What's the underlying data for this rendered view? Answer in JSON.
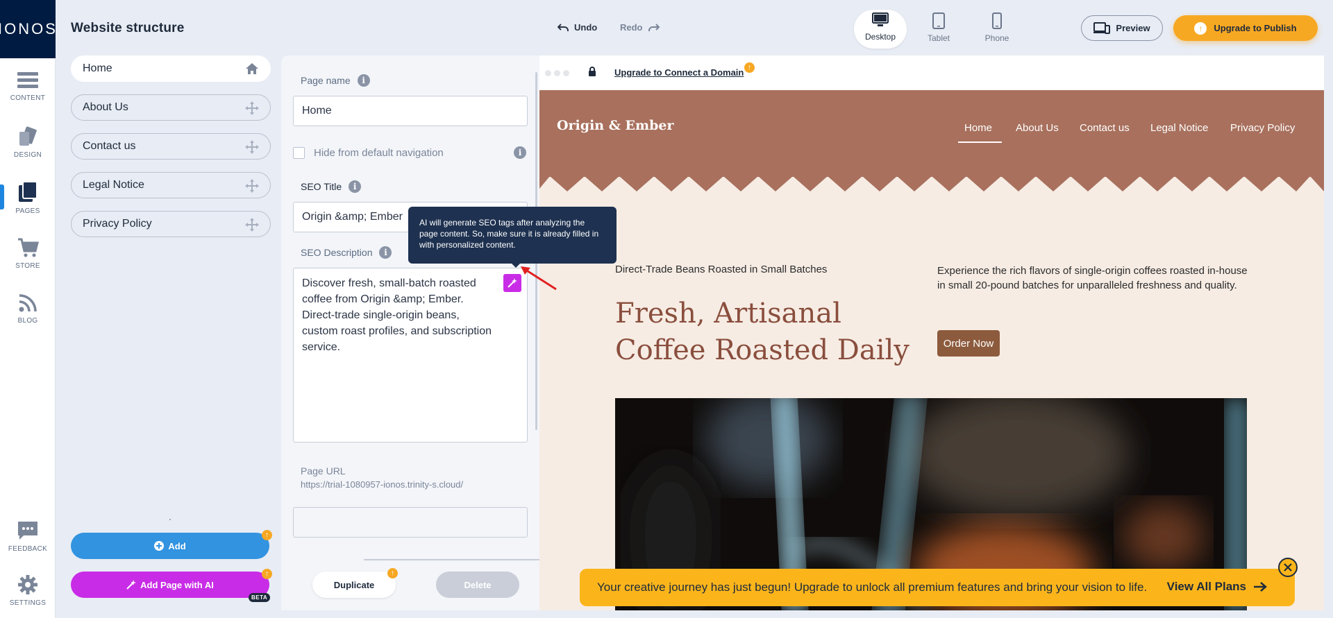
{
  "brand": {
    "logo": "IONOS"
  },
  "rail": {
    "items": [
      {
        "label": "CONTENT",
        "icon": "content-icon"
      },
      {
        "label": "DESIGN",
        "icon": "design-icon"
      },
      {
        "label": "PAGES",
        "icon": "pages-icon",
        "active": true
      },
      {
        "label": "STORE",
        "icon": "cart-icon"
      },
      {
        "label": "BLOG",
        "icon": "rss-icon"
      },
      {
        "label": "FEEDBACK",
        "icon": "feedback-icon"
      },
      {
        "label": "SETTINGS",
        "icon": "gear-icon"
      }
    ]
  },
  "header": {
    "title": "Website structure",
    "undo": "Undo",
    "redo": "Redo",
    "devices": [
      {
        "label": "Desktop",
        "active": true
      },
      {
        "label": "Tablet"
      },
      {
        "label": "Phone"
      }
    ],
    "preview": "Preview",
    "upgrade": "Upgrade to Publish"
  },
  "pages": {
    "items": [
      {
        "label": "Home",
        "icon": "home-icon",
        "active": true
      },
      {
        "label": "About Us",
        "icon": "move-icon"
      },
      {
        "label": "Contact us",
        "icon": "move-icon"
      },
      {
        "label": "Legal Notice",
        "icon": "move-icon"
      },
      {
        "label": "Privacy Policy",
        "icon": "move-icon"
      }
    ],
    "add": "Add",
    "add_ai": "Add Page with AI",
    "beta": "BETA"
  },
  "settings": {
    "page_name_label": "Page name",
    "page_name_value": "Home",
    "hide_nav_label": "Hide from default navigation",
    "seo_title_label": "SEO Title",
    "seo_title_value": "Origin &amp; Ember",
    "seo_desc_label": "SEO Description",
    "seo_desc_value": "Discover fresh, small-batch roasted coffee from Origin &amp; Ember. Direct-trade single-origin beans, custom roast profiles, and subscription service.",
    "page_url_label": "Page URL",
    "page_url_value": "https://trial-1080957-ionos.trinity-s.cloud/",
    "duplicate": "Duplicate",
    "delete": "Delete"
  },
  "tooltip": {
    "text": "AI will generate SEO tags after analyzing the page content. So, make sure it is already filled in with personalized content."
  },
  "preview": {
    "domain_link": "Upgrade to Connect a Domain",
    "site": {
      "brand": "Origin & Ember",
      "nav": [
        "Home",
        "About Us",
        "Contact us",
        "Legal Notice",
        "Privacy Policy"
      ],
      "hero_sub": "Direct-Trade Beans Roasted in Small Batches",
      "hero_title": "Fresh, Artisanal Coffee Roasted Daily",
      "hero_desc": "Experience the rich flavors of single-origin coffees roasted in-house in small 20-pound batches for unparalleled freshness and quality.",
      "order": "Order Now"
    },
    "header_color": "#a8705d"
  },
  "banner": {
    "text": "Your creative journey has just begun! Upgrade to unlock all premium features and bring your vision to life.",
    "link": "View All Plans"
  },
  "colors": {
    "accent_blue": "#3293e0",
    "accent_purple": "#c92ce6",
    "upgrade_orange": "#f7a823",
    "banner_yellow": "#fbb51b"
  }
}
